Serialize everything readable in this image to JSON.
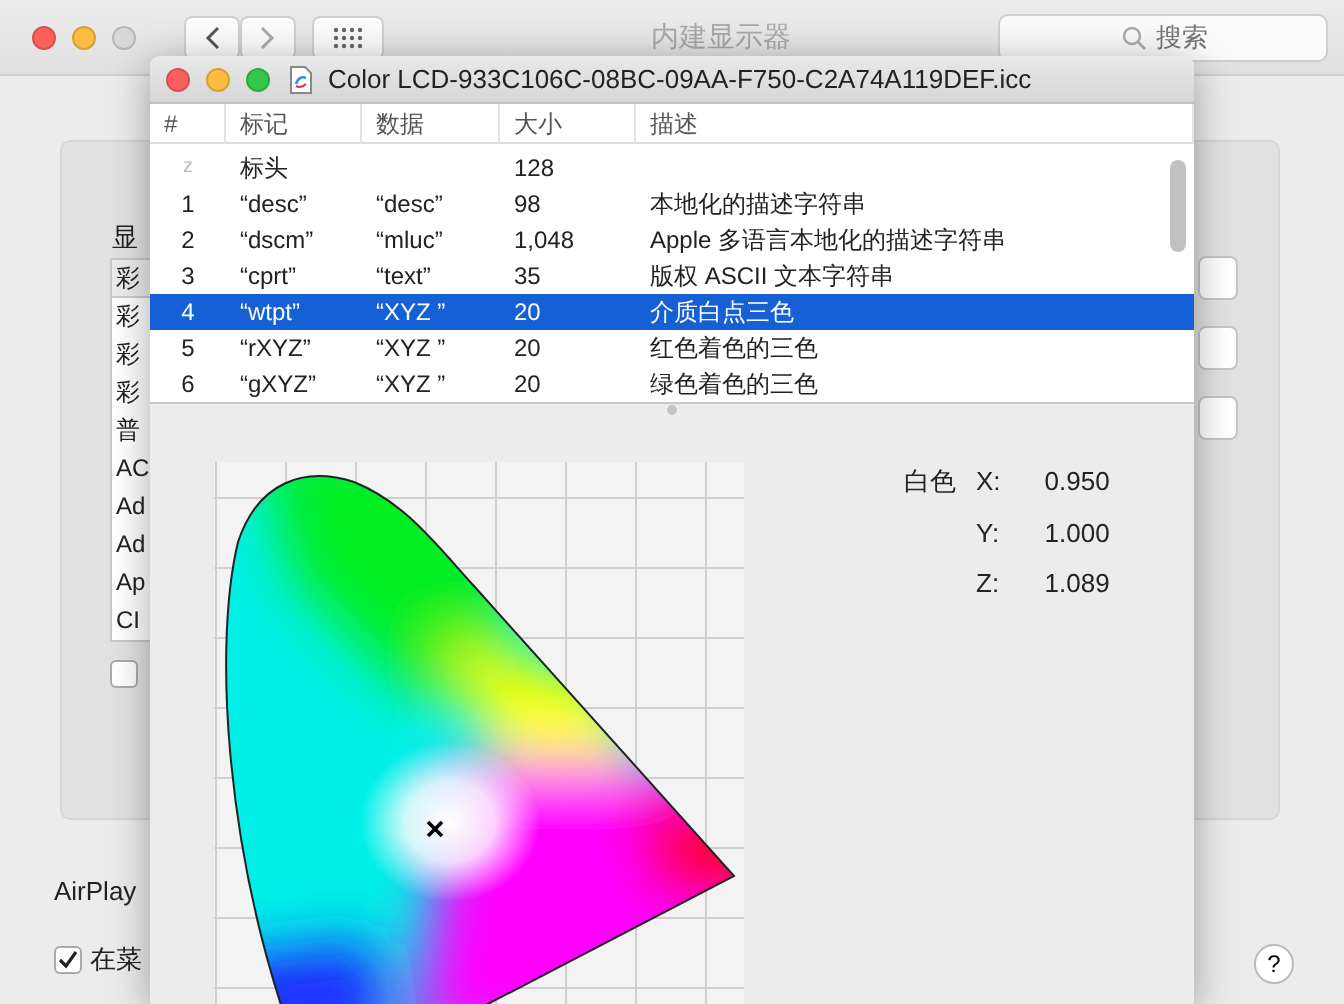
{
  "window": {
    "title": "内建显示器",
    "search": {
      "placeholder": "搜索"
    }
  },
  "panel": {
    "list_label": "显",
    "list_header": "彩",
    "list_items": [
      "彩",
      "彩",
      "彩",
      "普",
      "AC",
      "Ad",
      "Ad",
      "Ap",
      "CI"
    ],
    "checkbox": {
      "checked": false
    }
  },
  "airplay_label": "AirPlay",
  "menu_checkbox": {
    "label": "在菜",
    "checked": true
  },
  "help_button": "?",
  "profile_window": {
    "title": "Color LCD-933C106C-08BC-09AA-F750-C2A74A119DEF.icc",
    "columns": [
      "#",
      "标记",
      "数据",
      "大小",
      "描述"
    ],
    "rows": [
      {
        "kind": "header",
        "index": "z",
        "tag": "标头",
        "size": "128",
        "selected": false
      },
      {
        "kind": "tag",
        "index": "1",
        "tag": "“desc”",
        "data": "“desc”",
        "size": "98",
        "description": "本地化的描述字符串",
        "selected": false
      },
      {
        "kind": "tag",
        "index": "2",
        "tag": "“dscm”",
        "data": "“mluc”",
        "size": "1,048",
        "description": "Apple 多语言本地化的描述字符串",
        "selected": false
      },
      {
        "kind": "tag",
        "index": "3",
        "tag": "“cprt”",
        "data": "“text”",
        "size": "35",
        "description": "版权 ASCII 文本字符串",
        "selected": false
      },
      {
        "kind": "tag",
        "index": "4",
        "tag": "“wtpt”",
        "data": "“XYZ ”",
        "size": "20",
        "description": "介质白点三色",
        "selected": true
      },
      {
        "kind": "tag",
        "index": "5",
        "tag": "“rXYZ”",
        "data": "“XYZ ”",
        "size": "20",
        "description": "红色着色的三色",
        "selected": false
      },
      {
        "kind": "tag",
        "index": "6",
        "tag": "“gXYZ”",
        "data": "“XYZ ”",
        "size": "20",
        "description": "绿色着色的三色",
        "selected": false
      }
    ],
    "white_point": {
      "label": "白色",
      "values": [
        {
          "axis": "X:",
          "value": "0.950"
        },
        {
          "axis": "Y:",
          "value": "1.000"
        },
        {
          "axis": "Z:",
          "value": "1.089"
        }
      ]
    }
  }
}
